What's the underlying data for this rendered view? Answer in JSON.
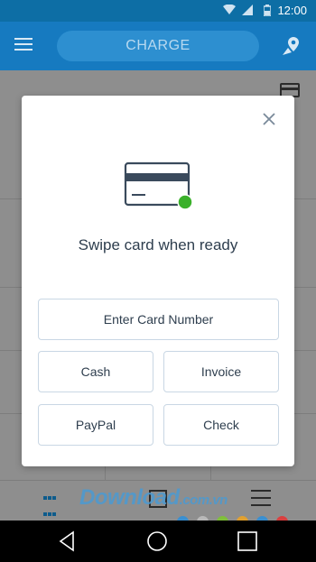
{
  "status_bar": {
    "time": "12:00"
  },
  "app_bar": {
    "charge_label": "CHARGE"
  },
  "modal": {
    "title": "Swipe card when ready",
    "buttons": {
      "enter_card_number": "Enter Card Number",
      "cash": "Cash",
      "invoice": "Invoice",
      "paypal": "PayPal",
      "check": "Check"
    }
  },
  "watermark": {
    "text": "Download",
    "suffix": ".com.vn"
  },
  "colors": {
    "app_bar": "#167ac0",
    "status_bar": "#0d6ea5",
    "accent_green": "#3ab02a",
    "card_dark": "#3a4a5c",
    "button_border": "#c9d7e4"
  },
  "icons": {
    "menu": "menu-icon",
    "location": "location-pin-icon",
    "close": "close-icon",
    "card": "credit-card-icon",
    "back": "back-icon",
    "home": "home-icon",
    "recents": "recents-icon"
  }
}
